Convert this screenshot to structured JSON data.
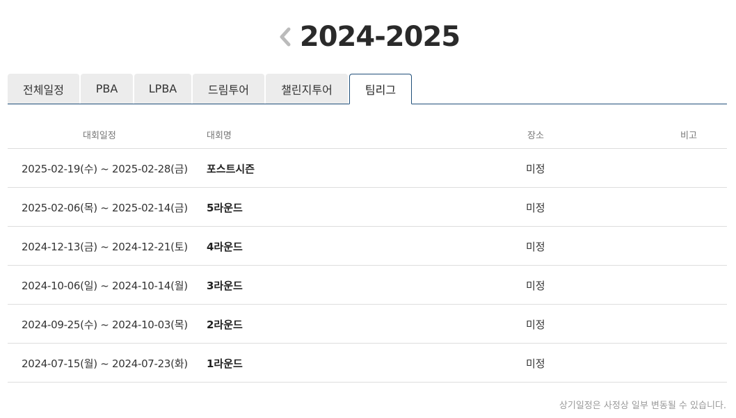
{
  "season": {
    "title": "2024-2025"
  },
  "tabs": [
    {
      "label": "전체일정",
      "active": false
    },
    {
      "label": "PBA",
      "active": false
    },
    {
      "label": "LPBA",
      "active": false
    },
    {
      "label": "드림투어",
      "active": false
    },
    {
      "label": "챌린지투어",
      "active": false
    },
    {
      "label": "팀리그",
      "active": true
    }
  ],
  "table": {
    "headers": {
      "date": "대회일정",
      "name": "대회명",
      "place": "장소",
      "note": "비고"
    },
    "rows": [
      {
        "date": "2025-02-19(수) ~ 2025-02-28(금)",
        "name": "포스트시즌",
        "place": "미정",
        "note": ""
      },
      {
        "date": "2025-02-06(목) ~ 2025-02-14(금)",
        "name": "5라운드",
        "place": "미정",
        "note": ""
      },
      {
        "date": "2024-12-13(금) ~ 2024-12-21(토)",
        "name": "4라운드",
        "place": "미정",
        "note": ""
      },
      {
        "date": "2024-10-06(일) ~ 2024-10-14(월)",
        "name": "3라운드",
        "place": "미정",
        "note": ""
      },
      {
        "date": "2024-09-25(수) ~ 2024-10-03(목)",
        "name": "2라운드",
        "place": "미정",
        "note": ""
      },
      {
        "date": "2024-07-15(월) ~ 2024-07-23(화)",
        "name": "1라운드",
        "place": "미정",
        "note": ""
      }
    ]
  },
  "footnote": "상기일정은 사정상 일부 변동될 수 있습니다.",
  "icons": {
    "prev": "chevron-left-icon"
  },
  "colors": {
    "accent": "#1f4e79",
    "tab_bg": "#ececec",
    "divider": "#dddddd"
  }
}
